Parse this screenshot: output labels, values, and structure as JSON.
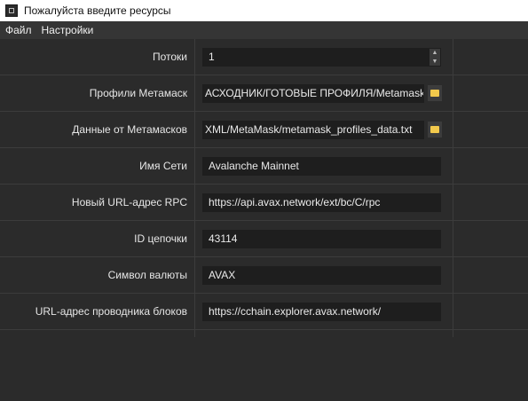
{
  "window": {
    "title": "Пожалуйста введите ресурсы"
  },
  "menu": {
    "file": "Файл",
    "settings": "Настройки"
  },
  "form": {
    "threads": {
      "label": "Потоки",
      "value": "1"
    },
    "profiles": {
      "label": "Профили Метамаск",
      "value": "АСХОДНИК/ГОТОВЫЕ ПРОФИЛЯ/Metamask"
    },
    "data": {
      "label": "Данные от Метамасков",
      "value": "XML/MetaMask/metamask_profiles_data.txt"
    },
    "network_name": {
      "label": "Имя Сети",
      "value": "Avalanche Mainnet"
    },
    "rpc_url": {
      "label": "Новый URL-адрес RPC",
      "value": "https://api.avax.network/ext/bc/C/rpc"
    },
    "chain_id": {
      "label": "ID цепочки",
      "value": "43114"
    },
    "currency": {
      "label": "Символ валюты",
      "value": "AVAX"
    },
    "explorer_url": {
      "label": "URL-адрес проводника блоков",
      "value": "https://cchain.explorer.avax.network/"
    }
  },
  "icons": {
    "spin_up": "▲",
    "spin_down": "▼"
  }
}
